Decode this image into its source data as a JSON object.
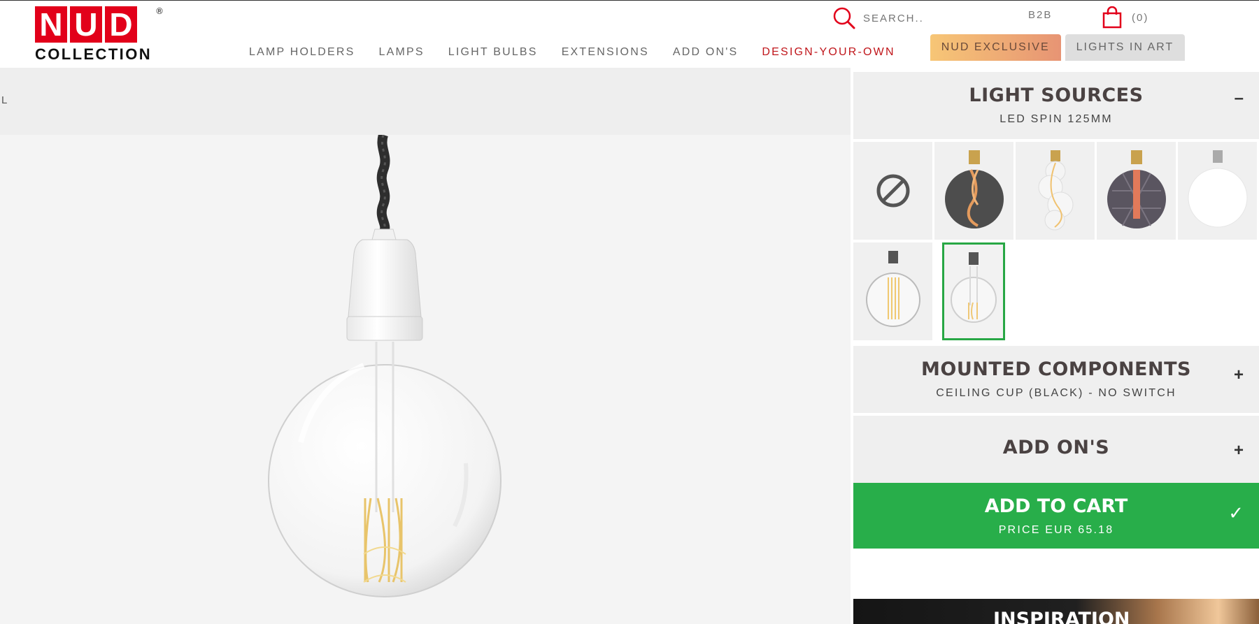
{
  "brand": {
    "letters": [
      "N",
      "U",
      "D"
    ],
    "registered": "®",
    "subtitle": "COLLECTION",
    "color": "#e2001a"
  },
  "header": {
    "search_placeholder": "SEARCH..",
    "search_icon": "search-icon",
    "b2b": "B2B",
    "cart_icon": "shopping-bag-icon",
    "cart_count": "(0)"
  },
  "nav": {
    "items": [
      "LAMP HOLDERS",
      "LAMPS",
      "LIGHT BULBS",
      "EXTENSIONS",
      "ADD ON'S",
      "DESIGN-YOUR-OWN"
    ],
    "exclusive": "NUD EXCLUSIVE",
    "lights_in_art": "LIGHTS IN ART",
    "accent_color": "#c0161b"
  },
  "preview": {
    "band_text": "L"
  },
  "configurator": {
    "light_sources": {
      "title": "LIGHT SOURCES",
      "selected": "LED SPIN 125MM",
      "toggle": "–"
    },
    "bulbs": [
      "none-icon",
      "smoke-globe-bulb-icon",
      "bubble-bulb-icon",
      "faceted-smoke-bulb-icon",
      "opal-globe-bulb-icon",
      "clear-globe-bulb-icon",
      "led-spin-globe-bulb-icon"
    ],
    "mounted_components": {
      "title": "MOUNTED COMPONENTS",
      "selected": "CEILING CUP (BLACK) - NO SWITCH",
      "toggle": "+"
    },
    "add_ons": {
      "title": "ADD ON'S",
      "toggle": "+"
    },
    "add_to_cart": {
      "title": "ADD TO CART",
      "price": "PRICE EUR 65.18",
      "check": "✓",
      "color": "#28ae4a"
    },
    "inspiration": "INSPIRATION"
  }
}
